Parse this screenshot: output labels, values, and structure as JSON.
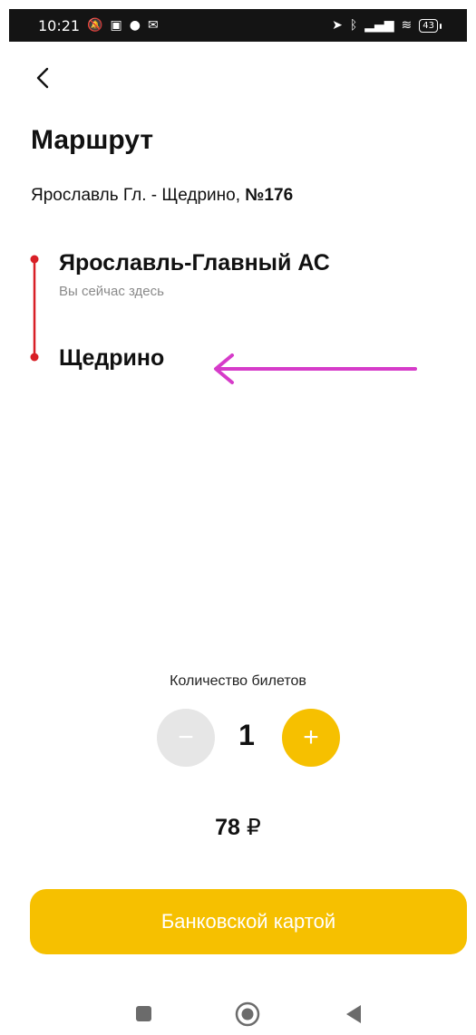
{
  "status_bar": {
    "time": "10:21",
    "left_icons": [
      "notifications-off-icon",
      "bus-icon",
      "check-circle-icon",
      "gmail-icon"
    ],
    "right_icons": [
      "location-icon",
      "bluetooth-icon",
      "signal-icon",
      "wifi-icon"
    ],
    "battery": "43"
  },
  "header": {
    "back_icon": "chevron-left-icon"
  },
  "page": {
    "title": "Маршрут",
    "route_name": "Ярославль Гл. - Щедрино,",
    "route_number": "№176"
  },
  "stops": [
    {
      "name": "Ярославль-Главный АС",
      "hint": "Вы сейчас здесь"
    },
    {
      "name": "Щедрино"
    }
  ],
  "tickets": {
    "label": "Количество билетов",
    "minus": "−",
    "count": "1",
    "plus": "+"
  },
  "price": {
    "amount": "78",
    "currency": "₽"
  },
  "pay_button": {
    "label": "Банковской картой"
  },
  "colors": {
    "accent": "#f6c000",
    "route_line": "#d81f26",
    "annotation_arrow": "#d63bc9",
    "disabled": "#e6e6e6"
  }
}
